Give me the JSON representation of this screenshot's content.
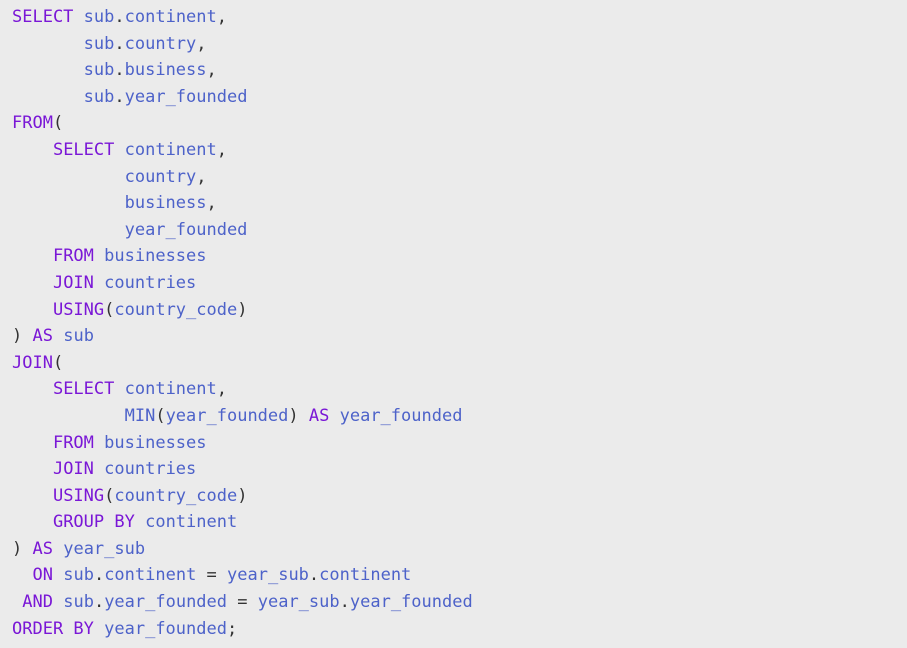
{
  "code_block": {
    "language": "sql",
    "colors": {
      "background": "#ebebeb",
      "keyword": "#7a17d6",
      "identifier": "#4d62c9",
      "punctuation": "#333333"
    },
    "lines": [
      [
        {
          "t": "kw",
          "s": "SELECT"
        },
        {
          "t": "p",
          "s": " "
        },
        {
          "t": "id",
          "s": "sub"
        },
        {
          "t": "p",
          "s": "."
        },
        {
          "t": "id",
          "s": "continent"
        },
        {
          "t": "p",
          "s": ","
        }
      ],
      [
        {
          "t": "p",
          "s": "       "
        },
        {
          "t": "id",
          "s": "sub"
        },
        {
          "t": "p",
          "s": "."
        },
        {
          "t": "id",
          "s": "country"
        },
        {
          "t": "p",
          "s": ","
        }
      ],
      [
        {
          "t": "p",
          "s": "       "
        },
        {
          "t": "id",
          "s": "sub"
        },
        {
          "t": "p",
          "s": "."
        },
        {
          "t": "id",
          "s": "business"
        },
        {
          "t": "p",
          "s": ","
        }
      ],
      [
        {
          "t": "p",
          "s": "       "
        },
        {
          "t": "id",
          "s": "sub"
        },
        {
          "t": "p",
          "s": "."
        },
        {
          "t": "id",
          "s": "year_founded"
        }
      ],
      [
        {
          "t": "kw",
          "s": "FROM"
        },
        {
          "t": "p",
          "s": "("
        }
      ],
      [
        {
          "t": "p",
          "s": "    "
        },
        {
          "t": "kw",
          "s": "SELECT"
        },
        {
          "t": "p",
          "s": " "
        },
        {
          "t": "id",
          "s": "continent"
        },
        {
          "t": "p",
          "s": ","
        }
      ],
      [
        {
          "t": "p",
          "s": "           "
        },
        {
          "t": "id",
          "s": "country"
        },
        {
          "t": "p",
          "s": ","
        }
      ],
      [
        {
          "t": "p",
          "s": "           "
        },
        {
          "t": "id",
          "s": "business"
        },
        {
          "t": "p",
          "s": ","
        }
      ],
      [
        {
          "t": "p",
          "s": "           "
        },
        {
          "t": "id",
          "s": "year_founded"
        }
      ],
      [
        {
          "t": "p",
          "s": "    "
        },
        {
          "t": "kw",
          "s": "FROM"
        },
        {
          "t": "p",
          "s": " "
        },
        {
          "t": "id",
          "s": "businesses"
        }
      ],
      [
        {
          "t": "p",
          "s": "    "
        },
        {
          "t": "kw",
          "s": "JOIN"
        },
        {
          "t": "p",
          "s": " "
        },
        {
          "t": "id",
          "s": "countries"
        }
      ],
      [
        {
          "t": "p",
          "s": "    "
        },
        {
          "t": "kw",
          "s": "USING"
        },
        {
          "t": "p",
          "s": "("
        },
        {
          "t": "id",
          "s": "country_code"
        },
        {
          "t": "p",
          "s": ")"
        }
      ],
      [
        {
          "t": "p",
          "s": ") "
        },
        {
          "t": "kw",
          "s": "AS"
        },
        {
          "t": "p",
          "s": " "
        },
        {
          "t": "id",
          "s": "sub"
        }
      ],
      [
        {
          "t": "kw",
          "s": "JOIN"
        },
        {
          "t": "p",
          "s": "("
        }
      ],
      [
        {
          "t": "p",
          "s": "    "
        },
        {
          "t": "kw",
          "s": "SELECT"
        },
        {
          "t": "p",
          "s": " "
        },
        {
          "t": "id",
          "s": "continent"
        },
        {
          "t": "p",
          "s": ","
        }
      ],
      [
        {
          "t": "p",
          "s": "           "
        },
        {
          "t": "id",
          "s": "MIN"
        },
        {
          "t": "p",
          "s": "("
        },
        {
          "t": "id",
          "s": "year_founded"
        },
        {
          "t": "p",
          "s": ") "
        },
        {
          "t": "kw",
          "s": "AS"
        },
        {
          "t": "p",
          "s": " "
        },
        {
          "t": "id",
          "s": "year_founded"
        }
      ],
      [
        {
          "t": "p",
          "s": "    "
        },
        {
          "t": "kw",
          "s": "FROM"
        },
        {
          "t": "p",
          "s": " "
        },
        {
          "t": "id",
          "s": "businesses"
        }
      ],
      [
        {
          "t": "p",
          "s": "    "
        },
        {
          "t": "kw",
          "s": "JOIN"
        },
        {
          "t": "p",
          "s": " "
        },
        {
          "t": "id",
          "s": "countries"
        }
      ],
      [
        {
          "t": "p",
          "s": "    "
        },
        {
          "t": "kw",
          "s": "USING"
        },
        {
          "t": "p",
          "s": "("
        },
        {
          "t": "id",
          "s": "country_code"
        },
        {
          "t": "p",
          "s": ")"
        }
      ],
      [
        {
          "t": "p",
          "s": "    "
        },
        {
          "t": "kw",
          "s": "GROUP BY"
        },
        {
          "t": "p",
          "s": " "
        },
        {
          "t": "id",
          "s": "continent"
        }
      ],
      [
        {
          "t": "p",
          "s": ") "
        },
        {
          "t": "kw",
          "s": "AS"
        },
        {
          "t": "p",
          "s": " "
        },
        {
          "t": "id",
          "s": "year_sub"
        }
      ],
      [
        {
          "t": "p",
          "s": "  "
        },
        {
          "t": "kw",
          "s": "ON"
        },
        {
          "t": "p",
          "s": " "
        },
        {
          "t": "id",
          "s": "sub"
        },
        {
          "t": "p",
          "s": "."
        },
        {
          "t": "id",
          "s": "continent"
        },
        {
          "t": "p",
          "s": " = "
        },
        {
          "t": "id",
          "s": "year_sub"
        },
        {
          "t": "p",
          "s": "."
        },
        {
          "t": "id",
          "s": "continent"
        }
      ],
      [
        {
          "t": "p",
          "s": " "
        },
        {
          "t": "kw",
          "s": "AND"
        },
        {
          "t": "p",
          "s": " "
        },
        {
          "t": "id",
          "s": "sub"
        },
        {
          "t": "p",
          "s": "."
        },
        {
          "t": "id",
          "s": "year_founded"
        },
        {
          "t": "p",
          "s": " = "
        },
        {
          "t": "id",
          "s": "year_sub"
        },
        {
          "t": "p",
          "s": "."
        },
        {
          "t": "id",
          "s": "year_founded"
        }
      ],
      [
        {
          "t": "kw",
          "s": "ORDER BY"
        },
        {
          "t": "p",
          "s": " "
        },
        {
          "t": "id",
          "s": "year_founded"
        },
        {
          "t": "p",
          "s": ";"
        }
      ]
    ]
  }
}
